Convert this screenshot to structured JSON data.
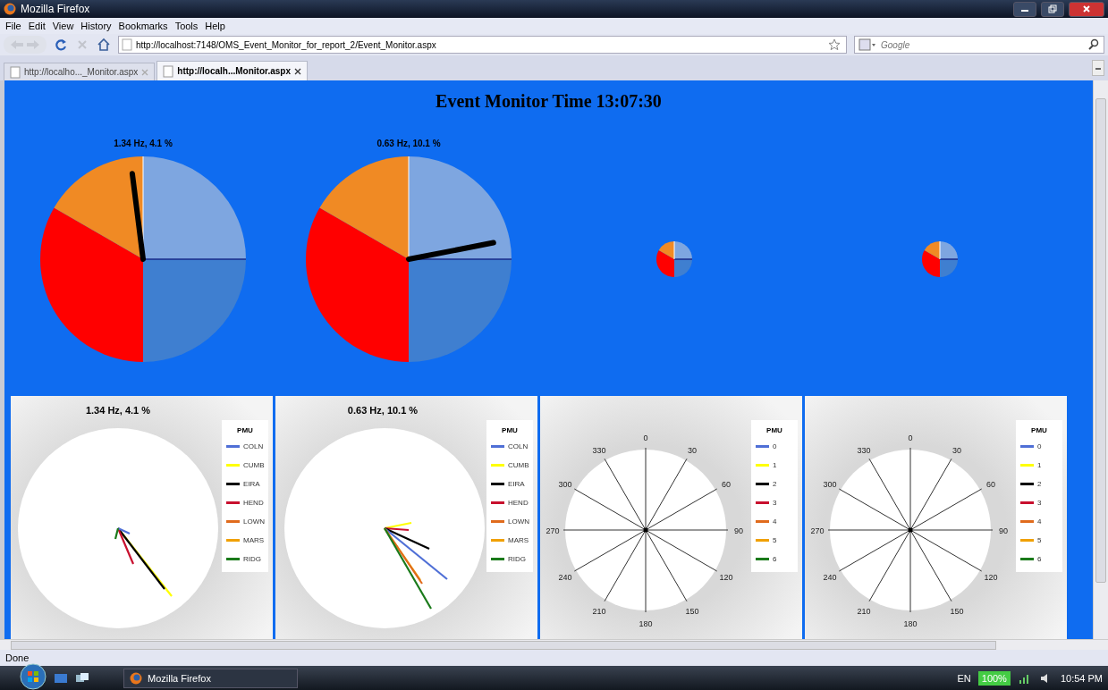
{
  "window": {
    "title": "Mozilla Firefox"
  },
  "menu": [
    "File",
    "Edit",
    "View",
    "History",
    "Bookmarks",
    "Tools",
    "Help"
  ],
  "address_bar": {
    "value": "http://localhost:7148/OMS_Event_Monitor_for_report_2/Event_Monitor.aspx"
  },
  "search": {
    "placeholder": "Google"
  },
  "tabs": [
    {
      "label": "http://localho..._Monitor.aspx",
      "selected": false
    },
    {
      "label": "http://localh...Monitor.aspx",
      "selected": true
    }
  ],
  "page": {
    "heading": "Event Monitor Time 13:07:30",
    "gauges": [
      {
        "kind": "large",
        "label": "1.34 Hz, 4.1 %"
      },
      {
        "kind": "large",
        "label": "0.63 Hz, 10.1 %"
      },
      {
        "kind": "small"
      },
      {
        "kind": "small"
      }
    ],
    "panels": [
      {
        "kind": "phasor",
        "title": "1.34 Hz, 4.1 %",
        "legend_title": "PMU",
        "legend": [
          {
            "name": "COLN",
            "color": "#4f6fd6"
          },
          {
            "name": "CUMB",
            "color": "#ffff00"
          },
          {
            "name": "EIRA",
            "color": "#000000"
          },
          {
            "name": "HEND",
            "color": "#c8102e"
          },
          {
            "name": "LOWN",
            "color": "#e06b1c"
          },
          {
            "name": "MARS",
            "color": "#f0a000"
          },
          {
            "name": "RIDG",
            "color": "#1a7a1a"
          }
        ]
      },
      {
        "kind": "phasor",
        "title": "0.63 Hz, 10.1 %",
        "legend_title": "PMU",
        "legend": [
          {
            "name": "COLN",
            "color": "#4f6fd6"
          },
          {
            "name": "CUMB",
            "color": "#ffff00"
          },
          {
            "name": "EIRA",
            "color": "#000000"
          },
          {
            "name": "HEND",
            "color": "#c8102e"
          },
          {
            "name": "LOWN",
            "color": "#e06b1c"
          },
          {
            "name": "MARS",
            "color": "#f0a000"
          },
          {
            "name": "RIDG",
            "color": "#1a7a1a"
          }
        ]
      },
      {
        "kind": "polar",
        "angle_labels": [
          "0",
          "30",
          "60",
          "90",
          "120",
          "150",
          "180",
          "210",
          "240",
          "270",
          "300",
          "330"
        ],
        "legend_title": "PMU",
        "legend": [
          {
            "name": "0",
            "color": "#4f6fd6"
          },
          {
            "name": "1",
            "color": "#ffff00"
          },
          {
            "name": "2",
            "color": "#000000"
          },
          {
            "name": "3",
            "color": "#c8102e"
          },
          {
            "name": "4",
            "color": "#e06b1c"
          },
          {
            "name": "5",
            "color": "#f0a000"
          },
          {
            "name": "6",
            "color": "#1a7a1a"
          }
        ]
      },
      {
        "kind": "polar",
        "angle_labels": [
          "0",
          "30",
          "60",
          "90",
          "120",
          "150",
          "180",
          "210",
          "240",
          "270",
          "300",
          "330"
        ],
        "legend_title": "PMU",
        "legend": [
          {
            "name": "0",
            "color": "#4f6fd6"
          },
          {
            "name": "1",
            "color": "#ffff00"
          },
          {
            "name": "2",
            "color": "#000000"
          },
          {
            "name": "3",
            "color": "#c8102e"
          },
          {
            "name": "4",
            "color": "#e06b1c"
          },
          {
            "name": "5",
            "color": "#f0a000"
          },
          {
            "name": "6",
            "color": "#1a7a1a"
          }
        ]
      }
    ]
  },
  "status_bar": "Done",
  "taskbar": {
    "task": "Mozilla Firefox",
    "language": "EN",
    "battery": "100%",
    "clock": "10:54 PM"
  }
}
